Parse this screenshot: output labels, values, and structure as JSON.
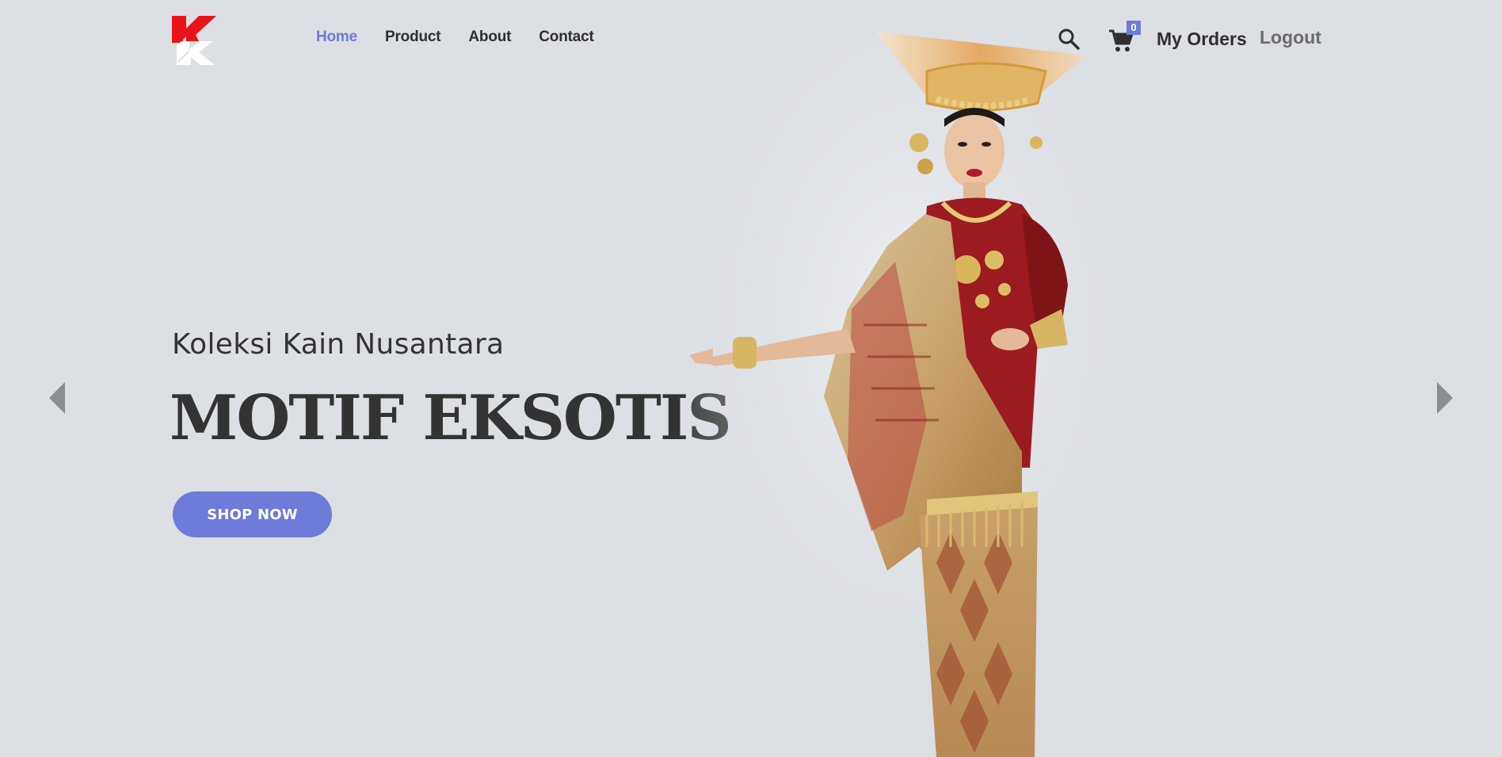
{
  "brand": {
    "logo_letter": "K",
    "colors": {
      "logo_red": "#e8141a",
      "accent": "#6f7bd8",
      "background": "#dcdfe4"
    }
  },
  "nav": {
    "items": [
      {
        "label": "Home",
        "active": true
      },
      {
        "label": "Product",
        "active": false
      },
      {
        "label": "About",
        "active": false
      },
      {
        "label": "Contact",
        "active": false
      }
    ]
  },
  "header": {
    "search_icon": "search-icon",
    "cart_icon": "cart-icon",
    "cart_count": "0",
    "my_orders_label": "My Orders",
    "logout_label": "Logout"
  },
  "hero": {
    "subtitle": "Koleksi Kain Nusantara",
    "title": "MOTIF EKSOTIS",
    "cta_label": "SHOP NOW",
    "image": "woman-in-traditional-minangkabau-costume"
  },
  "carousel": {
    "prev_icon": "caret-left-icon",
    "next_icon": "caret-right-icon"
  }
}
